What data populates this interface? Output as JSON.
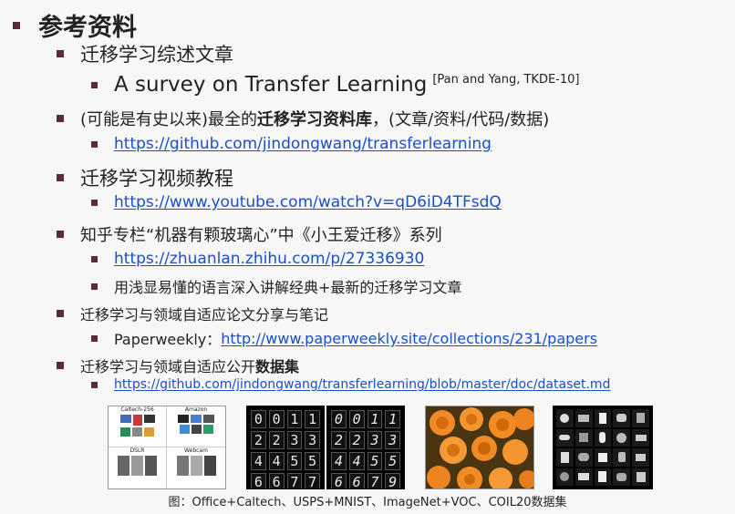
{
  "title": "参考资料",
  "items": [
    {
      "text": "迁移学习综述文章",
      "sub": {
        "text": "A survey on Transfer Learning",
        "citation": "[Pan and Yang, TKDE-10]"
      }
    },
    {
      "text_prefix": "(可能是有史以来)最全的",
      "text_bold": "迁移学习资料库",
      "text_suffix": "，(文章/资料/代码/数据)",
      "link": "https://github.com/jindongwang/transferlearning"
    },
    {
      "text": "迁移学习视频教程",
      "link": "https://www.youtube.com/watch?v=qD6iD4TFsdQ"
    },
    {
      "text": "知乎专栏“机器有颗玻璃心”中《小王爱迁移》系列",
      "link": "https://zhuanlan.zhihu.com/p/27336930",
      "sub_text": "用浅显易懂的语言深入讲解经典+最新的迁移学习文章"
    },
    {
      "text": "迁移学习与领域自适应论文分享与笔记",
      "sub_label": "Paperweekly：",
      "link": "http://www.paperweekly.site/collections/231/papers"
    },
    {
      "text_prefix": "迁移学习与领域自适应公开",
      "text_bold": "数据集",
      "link": "https://github.com/jindongwang/transferlearning/blob/master/doc/dataset.md"
    }
  ],
  "figures": {
    "office_labels": [
      "Caltech-256",
      "Amazon",
      "DSLR",
      "Webcam"
    ],
    "usps_digits": [
      "0",
      "0",
      "1",
      "1",
      "2",
      "2",
      "3",
      "3",
      "4",
      "4",
      "5",
      "5",
      "6",
      "6",
      "7",
      "7"
    ],
    "mnist_digits": [
      "0",
      "0",
      "1",
      "1",
      "2",
      "2",
      "3",
      "3",
      "4",
      "4",
      "5",
      "5",
      "6",
      "6",
      "7",
      "9"
    ],
    "caption": "图：Office+Caltech、USPS+MNIST、ImageNet+VOC、COIL20数据集"
  },
  "colors": {
    "bullet": "#5c2a3d",
    "link": "#1a4fc6",
    "background": "#f7f7f7"
  }
}
